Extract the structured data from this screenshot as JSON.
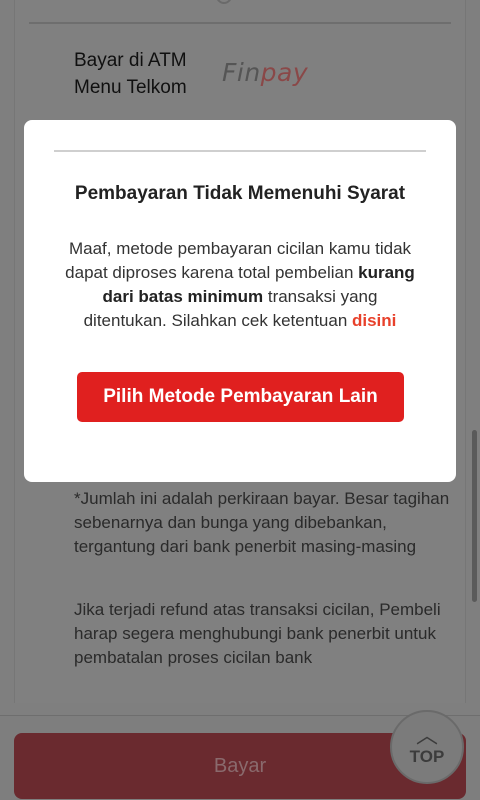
{
  "background": {
    "payment_option": {
      "label_line1": "Bayar di ATM",
      "label_line2": "Menu Telkom",
      "logo_fin": "Fin",
      "logo_pay": "pay"
    },
    "note1": "*Jumlah ini adalah perkiraan bayar. Besar tagihan sebenarnya dan bunga yang dibebankan, tergantung dari bank penerbit masing-masing",
    "note2": "Jika terjadi refund atas transaksi cicilan, Pembeli harap segera menghubungi bank penerbit untuk pembatalan proses cicilan bank"
  },
  "modal": {
    "title": "Pembayaran Tidak Memenuhi Syarat",
    "body_part1": "Maaf, metode pembayaran cicilan kamu tidak dapat diproses karena total pembelian ",
    "body_bold": "kurang dari batas minimum",
    "body_part2": " transaksi yang ditentukan. Silahkan cek ketentuan ",
    "body_link": "disini",
    "button_label": "Pilih Metode Pembayaran Lain"
  },
  "footer": {
    "pay_button_label": "Bayar",
    "top_button_label": "TOP",
    "top_button_icon": "chevron-up-icon"
  },
  "colors": {
    "accent_red": "#e0201f",
    "link_orange": "#e8412b"
  }
}
